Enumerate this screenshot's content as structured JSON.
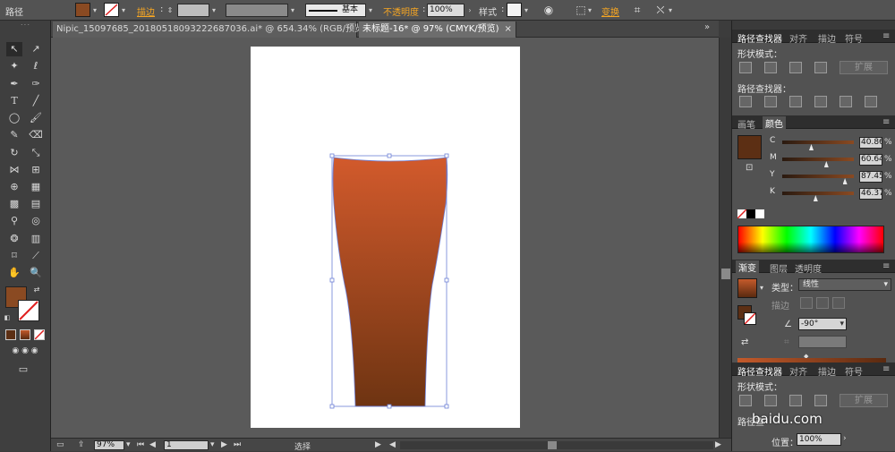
{
  "control_bar": {
    "path_label": "路径",
    "stroke_label": "描边",
    "stroke_weight": "",
    "brush_label": "基本",
    "opacity_label": "不透明度",
    "opacity_value": "100%",
    "style_label": "样式",
    "transform_label": "变换"
  },
  "tabs": [
    {
      "label": "Nipic_15097685_20180518093222687036.ai* @ 654.34% (RGB/预览)"
    },
    {
      "label": "未标题-16* @ 97% (CMYK/预览)"
    }
  ],
  "tab_close_glyph": "×",
  "tools": {
    "fill_color": "#8a4a22",
    "stroke_color": "none"
  },
  "artwork": {
    "gradient_top": "#d25a2c",
    "gradient_bottom": "#6e3412",
    "selection_color": "#6d7fd6"
  },
  "status_bar": {
    "zoom": "97%",
    "page": "1",
    "mode": "选择"
  },
  "pathfinder_panel": {
    "tabs": [
      "路径查找器",
      "对齐",
      "描边",
      "符号"
    ],
    "shape_modes_label": "形状模式：",
    "expand_label": "扩展",
    "pathfinders_label": "路径查找器："
  },
  "color_panel": {
    "tabs": [
      "画笔",
      "颜色"
    ],
    "swatch": "#5c2f14",
    "channels": [
      {
        "name": "C",
        "value": "40.86",
        "pct": 0.4,
        "unit": "%"
      },
      {
        "name": "M",
        "value": "60.64",
        "pct": 0.61,
        "unit": "%"
      },
      {
        "name": "Y",
        "value": "87.45",
        "pct": 0.87,
        "unit": "%"
      },
      {
        "name": "K",
        "value": "46.37",
        "pct": 0.46,
        "unit": "%"
      }
    ]
  },
  "gradient_panel": {
    "tabs": [
      "渐变",
      "图层",
      "透明度"
    ],
    "type_label": "类型：",
    "type_value": "线性",
    "stroke_label": "描边",
    "angle_value": "-90°",
    "gradient_start": "#c45a2b",
    "gradient_end": "#5a2a10"
  },
  "pathfinder_panel_2": {
    "tabs": [
      "路径查找器",
      "对齐",
      "描边",
      "符号"
    ],
    "shape_modes_label": "形状模式：",
    "expand_label": "扩展",
    "pathfinders_label": "路径查",
    "position_label": "位置：",
    "position_value": "100%"
  },
  "watermark": "baidu.com"
}
